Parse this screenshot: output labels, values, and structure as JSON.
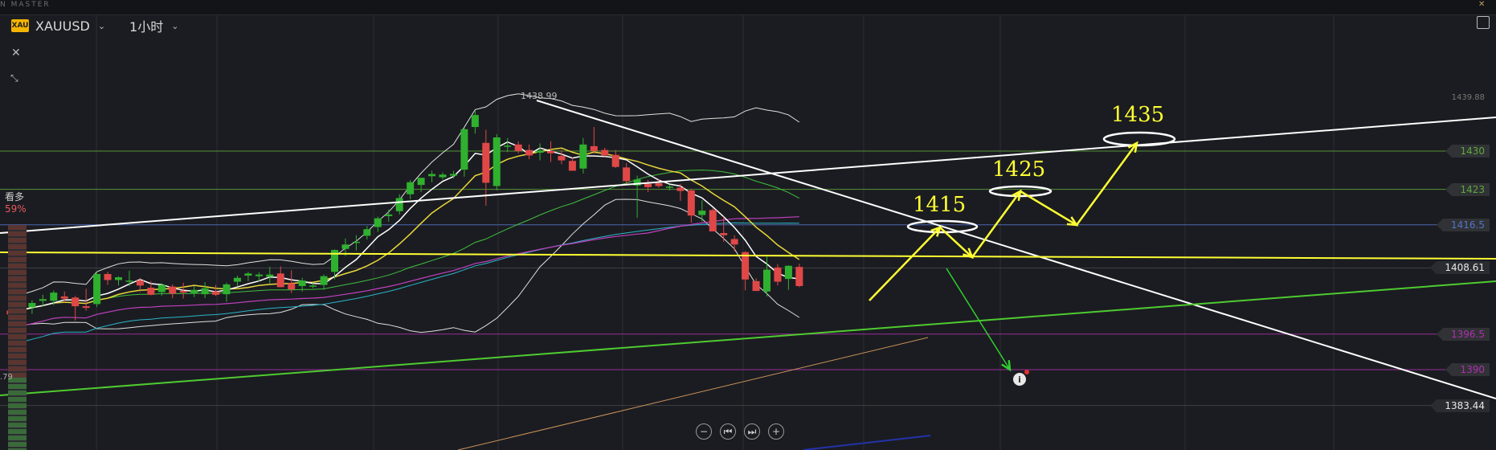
{
  "app": {
    "brand": "N MASTER"
  },
  "toolbar": {
    "symbol_logo": "XAU",
    "symbol": "XAUUSD",
    "interval": "1小时",
    "close_icon": "✕",
    "shrink_icon": "⤡"
  },
  "sentiment": {
    "label": "看多",
    "value": "59%"
  },
  "left_edge_value": ".79",
  "navigation": {
    "zoom_out": "−",
    "back": "⏮",
    "forward": "⏭",
    "zoom_in": "+"
  },
  "colors": {
    "bull": "#2fb12f",
    "bear": "#e04848",
    "trend": "#ffffff",
    "yellow": "#ffff33",
    "magenta": "#c040c0",
    "green_line": "#4ecb30",
    "blue_level": "#5573c8"
  },
  "chart_data": {
    "type": "candlestick",
    "symbol": "XAUUSD",
    "timeframe": "1小时",
    "high_marker": "1438.99",
    "top_right_value": "1439.88",
    "price_levels": [
      {
        "label": "1430",
        "value": 1430,
        "color": "#5ea83c"
      },
      {
        "label": "1423",
        "value": 1423,
        "color": "#5ea83c"
      },
      {
        "label": "1416.5",
        "value": 1416.5,
        "color": "#5573c8"
      },
      {
        "label": "1408.61",
        "value": 1408.61,
        "color": "#444549"
      },
      {
        "label": "1396.5",
        "value": 1396.5,
        "color": "#b030b0"
      },
      {
        "label": "1390",
        "value": 1390,
        "color": "#b030b0"
      },
      {
        "label": "1383.44",
        "value": 1383.44,
        "color": "#444549"
      }
    ],
    "annotations": [
      {
        "label": "1415",
        "value": 1415
      },
      {
        "label": "1425",
        "value": 1425
      },
      {
        "label": "1435",
        "value": 1435
      }
    ],
    "candles": [
      [
        1400.8,
        1401.6,
        1399.3,
        1400.1
      ],
      [
        1400.3,
        1402.0,
        1399.7,
        1401.7
      ],
      [
        1401.4,
        1402.7,
        1400.2,
        1402.2
      ],
      [
        1402.6,
        1403.7,
        1401.6,
        1402.9
      ],
      [
        1402.6,
        1404.5,
        1401.8,
        1404.1
      ],
      [
        1403.4,
        1404.3,
        1402.3,
        1403.0
      ],
      [
        1403.2,
        1403.5,
        1399.0,
        1401.6
      ],
      [
        1401.6,
        1404.8,
        1400.8,
        1401.3
      ],
      [
        1402.0,
        1408.0,
        1401.5,
        1407.5
      ],
      [
        1407.5,
        1407.9,
        1405.5,
        1406.4
      ],
      [
        1406.4,
        1407.1,
        1405.4,
        1406.9
      ],
      [
        1406.2,
        1408.1,
        1405.3,
        1406.3
      ],
      [
        1406.3,
        1406.8,
        1404.2,
        1405.4
      ],
      [
        1405.0,
        1406.2,
        1403.6,
        1403.7
      ],
      [
        1404.2,
        1405.8,
        1403.5,
        1405.5
      ],
      [
        1405.2,
        1405.6,
        1403.1,
        1403.9
      ],
      [
        1404.4,
        1405.9,
        1403.0,
        1404.1
      ],
      [
        1404.0,
        1405.3,
        1403.3,
        1404.6
      ],
      [
        1403.8,
        1406.0,
        1403.1,
        1404.9
      ],
      [
        1404.3,
        1405.5,
        1403.5,
        1403.7
      ],
      [
        1403.8,
        1405.9,
        1402.4,
        1405.6
      ],
      [
        1406.1,
        1407.2,
        1405.2,
        1406.8
      ],
      [
        1407.2,
        1407.9,
        1406.2,
        1407.6
      ],
      [
        1407.1,
        1407.8,
        1406.1,
        1407.4
      ],
      [
        1407.0,
        1408.8,
        1405.8,
        1407.4
      ],
      [
        1407.6,
        1408.9,
        1405.1,
        1405.1
      ],
      [
        1405.8,
        1408.2,
        1404.0,
        1404.7
      ],
      [
        1405.3,
        1406.8,
        1404.3,
        1406.3
      ],
      [
        1405.4,
        1405.9,
        1404.9,
        1405.4
      ],
      [
        1405.5,
        1407.4,
        1404.6,
        1407.1
      ],
      [
        1407.9,
        1412.0,
        1406.5,
        1411.9
      ],
      [
        1412.1,
        1414.0,
        1410.8,
        1412.9
      ],
      [
        1413.2,
        1414.6,
        1411.8,
        1413.4
      ],
      [
        1414.5,
        1416.3,
        1413.8,
        1415.7
      ],
      [
        1416.1,
        1418.0,
        1415.2,
        1417.7
      ],
      [
        1418.1,
        1419.3,
        1417.1,
        1418.4
      ],
      [
        1419.0,
        1422.1,
        1418.4,
        1421.4
      ],
      [
        1422.1,
        1424.7,
        1421.2,
        1424.3
      ],
      [
        1423.8,
        1425.1,
        1422.5,
        1425.1
      ],
      [
        1425.4,
        1426.4,
        1424.3,
        1425.8
      ],
      [
        1425.2,
        1426.1,
        1424.8,
        1425.7
      ],
      [
        1425.5,
        1426.4,
        1425.0,
        1425.8
      ],
      [
        1426.6,
        1434.3,
        1425.3,
        1434.0
      ],
      [
        1434.4,
        1437.5,
        1433.2,
        1436.6
      ],
      [
        1431.5,
        1433.9,
        1420.0,
        1424.2
      ],
      [
        1423.6,
        1433.1,
        1422.8,
        1432.5
      ],
      [
        1430.8,
        1432.4,
        1429.8,
        1431.0
      ],
      [
        1431.2,
        1431.8,
        1429.6,
        1430.0
      ],
      [
        1430.2,
        1431.2,
        1428.5,
        1429.2
      ],
      [
        1429.7,
        1431.4,
        1428.3,
        1430.1
      ],
      [
        1430.0,
        1431.8,
        1428.0,
        1429.6
      ],
      [
        1429.1,
        1430.2,
        1427.6,
        1428.3
      ],
      [
        1428.2,
        1428.8,
        1426.4,
        1426.4
      ],
      [
        1426.8,
        1432.4,
        1425.9,
        1431.2
      ],
      [
        1430.9,
        1434.4,
        1429.5,
        1430.0
      ],
      [
        1430.2,
        1430.6,
        1429.0,
        1429.2
      ],
      [
        1429.3,
        1430.2,
        1426.9,
        1427.1
      ],
      [
        1427.0,
        1427.8,
        1423.9,
        1424.5
      ],
      [
        1423.7,
        1425.5,
        1417.8,
        1424.8
      ],
      [
        1424.0,
        1424.7,
        1422.5,
        1423.4
      ],
      [
        1424.1,
        1424.9,
        1423.3,
        1423.6
      ],
      [
        1423.4,
        1423.9,
        1422.8,
        1423.5
      ],
      [
        1423.3,
        1424.0,
        1420.9,
        1422.7
      ],
      [
        1422.8,
        1423.1,
        1416.9,
        1418.2
      ],
      [
        1418.3,
        1421.0,
        1417.1,
        1419.1
      ],
      [
        1419.2,
        1419.5,
        1415.3,
        1415.3
      ],
      [
        1415.0,
        1418.0,
        1413.4,
        1414.6
      ],
      [
        1413.9,
        1414.6,
        1411.7,
        1412.9
      ],
      [
        1411.5,
        1411.7,
        1404.5,
        1406.5
      ],
      [
        1406.2,
        1406.7,
        1404.4,
        1404.4
      ],
      [
        1404.3,
        1410.7,
        1403.4,
        1408.3
      ],
      [
        1408.7,
        1409.3,
        1405.4,
        1406.1
      ],
      [
        1406.6,
        1409.1,
        1404.6,
        1409.0
      ],
      [
        1408.8,
        1409.4,
        1405.1,
        1405.3
      ]
    ]
  }
}
